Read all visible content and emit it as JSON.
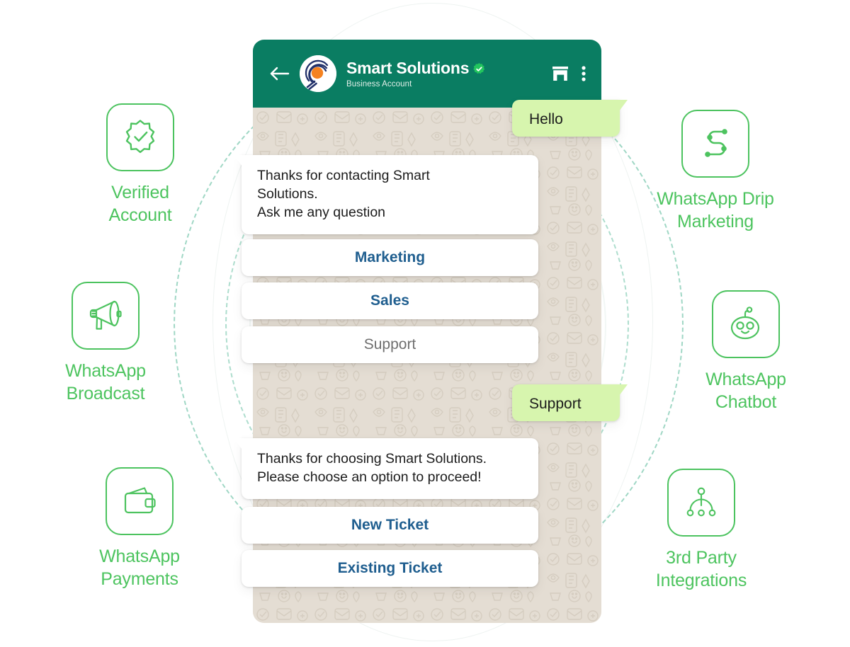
{
  "palette": {
    "whatsapp_header_green": "#0a7d62",
    "feature_green": "#4dc45f",
    "bubble_out_green": "#d7f5ae",
    "bubble_in_white": "#ffffff",
    "option_blue": "#1f5e8f",
    "option_gray": "#6f6f6f",
    "chat_bg_beige": "#e4ddd3",
    "dashed_ring_teal": "#7cc9b0",
    "avatar_orange": "#f58220",
    "avatar_navy": "#23326b"
  },
  "phone": {
    "header": {
      "back_icon": "back-arrow-icon",
      "avatar_icon": "business-avatar",
      "account_name": "Smart Solutions",
      "verified_icon": "verified-badge-icon",
      "subtitle": "Business Account",
      "storefront_icon": "storefront-icon",
      "overflow_icon": "more-vertical-icon"
    },
    "conversation": [
      {
        "id": "msg-hello",
        "direction": "outgoing",
        "text": "Hello"
      },
      {
        "id": "msg-greeting",
        "direction": "incoming",
        "lines": [
          "Thanks for contacting Smart",
          "Solutions.",
          "Ask me any question"
        ]
      },
      {
        "id": "option-marketing",
        "direction": "option",
        "text": "Marketing",
        "style": "primary"
      },
      {
        "id": "option-sales",
        "direction": "option",
        "text": "Sales",
        "style": "primary"
      },
      {
        "id": "option-support",
        "direction": "option",
        "text": "Support",
        "style": "muted"
      },
      {
        "id": "msg-support",
        "direction": "outgoing",
        "text": "Support"
      },
      {
        "id": "msg-thanks",
        "direction": "incoming",
        "lines": [
          "Thanks for choosing Smart Solutions.",
          "Please choose an option to proceed!"
        ]
      },
      {
        "id": "option-new-ticket",
        "direction": "option",
        "text": "New Ticket",
        "style": "primary"
      },
      {
        "id": "option-existing-ticket",
        "direction": "option",
        "text": "Existing Ticket",
        "style": "primary"
      }
    ]
  },
  "features_left": [
    {
      "icon": "verified-seal-icon",
      "line1": "Verified",
      "line2": "Account"
    },
    {
      "icon": "megaphone-icon",
      "line1": "WhatsApp",
      "line2": "Broadcast"
    },
    {
      "icon": "wallet-icon",
      "line1": "WhatsApp",
      "line2": "Payments"
    }
  ],
  "features_right": [
    {
      "icon": "flow-nodes-icon",
      "line1": "WhatsApp Drip",
      "line2": "Marketing"
    },
    {
      "icon": "robot-face-icon",
      "line1": "WhatsApp",
      "line2": "Chatbot"
    },
    {
      "icon": "hierarchy-tree-icon",
      "line1": "3rd Party",
      "line2": "Integrations"
    }
  ]
}
